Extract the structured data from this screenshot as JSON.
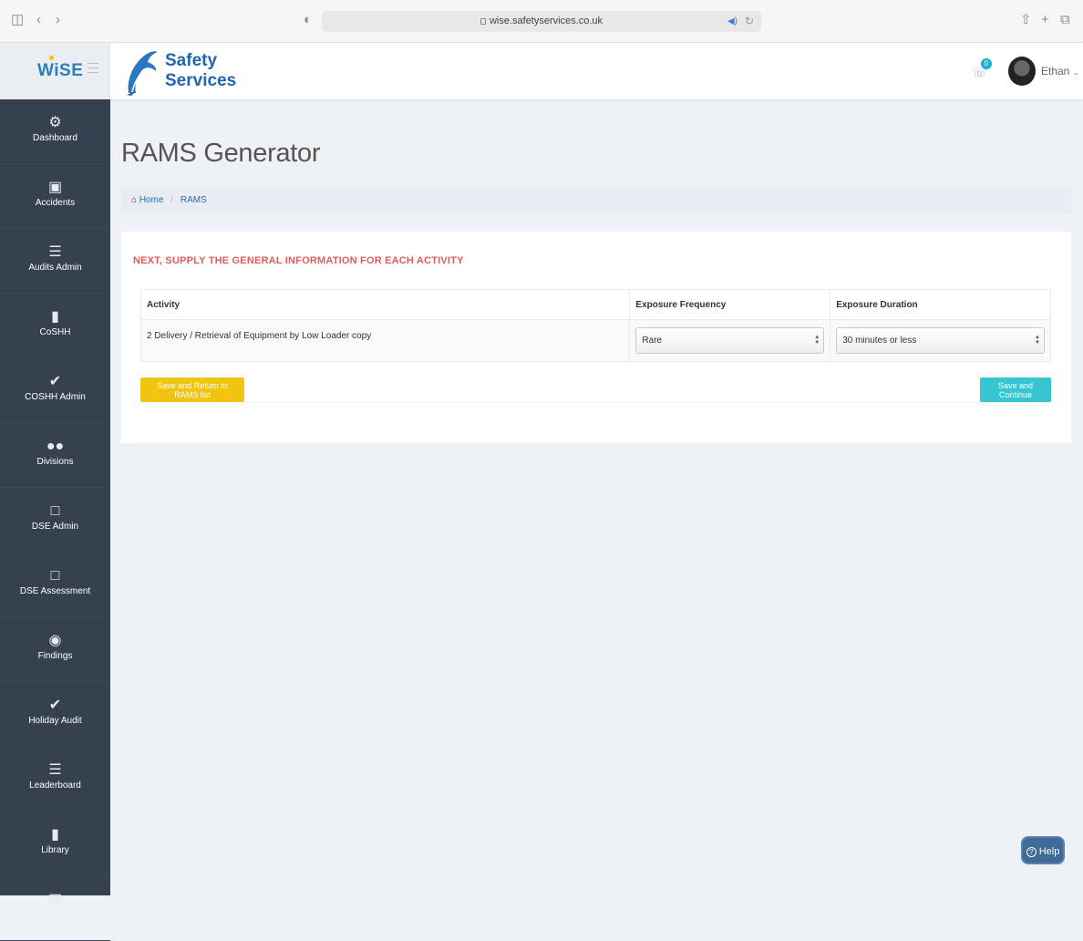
{
  "browser": {
    "url": "wise.safetyservices.co.uk"
  },
  "brand": {
    "app_logo": "WiSE",
    "company_line1": "Safety",
    "company_line2": "Services"
  },
  "header": {
    "notification_count": "0",
    "user_name": "Ethan"
  },
  "sidebar": {
    "items": [
      {
        "label": "Dashboard",
        "icon": "dashboard-icon"
      },
      {
        "label": "Accidents",
        "icon": "medkit-icon"
      },
      {
        "label": "Audits Admin",
        "icon": "list-icon"
      },
      {
        "label": "CoSHH",
        "icon": "book-icon"
      },
      {
        "label": "COSHH Admin",
        "icon": "check-icon"
      },
      {
        "label": "Divisions",
        "icon": "users-icon"
      },
      {
        "label": "DSE Admin",
        "icon": "monitor-icon"
      },
      {
        "label": "DSE Assessment",
        "icon": "monitor-icon"
      },
      {
        "label": "Findings",
        "icon": "eye-icon"
      },
      {
        "label": "Holiday Audit",
        "icon": "check-icon"
      },
      {
        "label": "Leaderboard",
        "icon": "list-icon"
      },
      {
        "label": "Library",
        "icon": "book-icon"
      }
    ]
  },
  "page": {
    "title": "RAMS Generator"
  },
  "breadcrumb": {
    "home": "Home",
    "current": "RAMS"
  },
  "card": {
    "title": "NEXT, SUPPLY THE GENERAL INFORMATION FOR EACH ACTIVITY",
    "columns": {
      "activity": "Activity",
      "frequency": "Exposure Frequency",
      "duration": "Exposure Duration"
    },
    "rows": [
      {
        "activity": "2 Delivery / Retrieval of Equipment by Low Loader copy",
        "frequency": "Rare",
        "duration": "30 minutes or less"
      }
    ],
    "save_return_label": "Save and Return to RAMS list",
    "save_continue_label": "Save and Continue"
  },
  "help": {
    "label": "Help"
  },
  "colors": {
    "sidebar": "#364150",
    "accent_title": "#e05c56",
    "save_return": "#f1c40f",
    "save_continue": "#36c6d3",
    "help": "#3e6b98"
  }
}
